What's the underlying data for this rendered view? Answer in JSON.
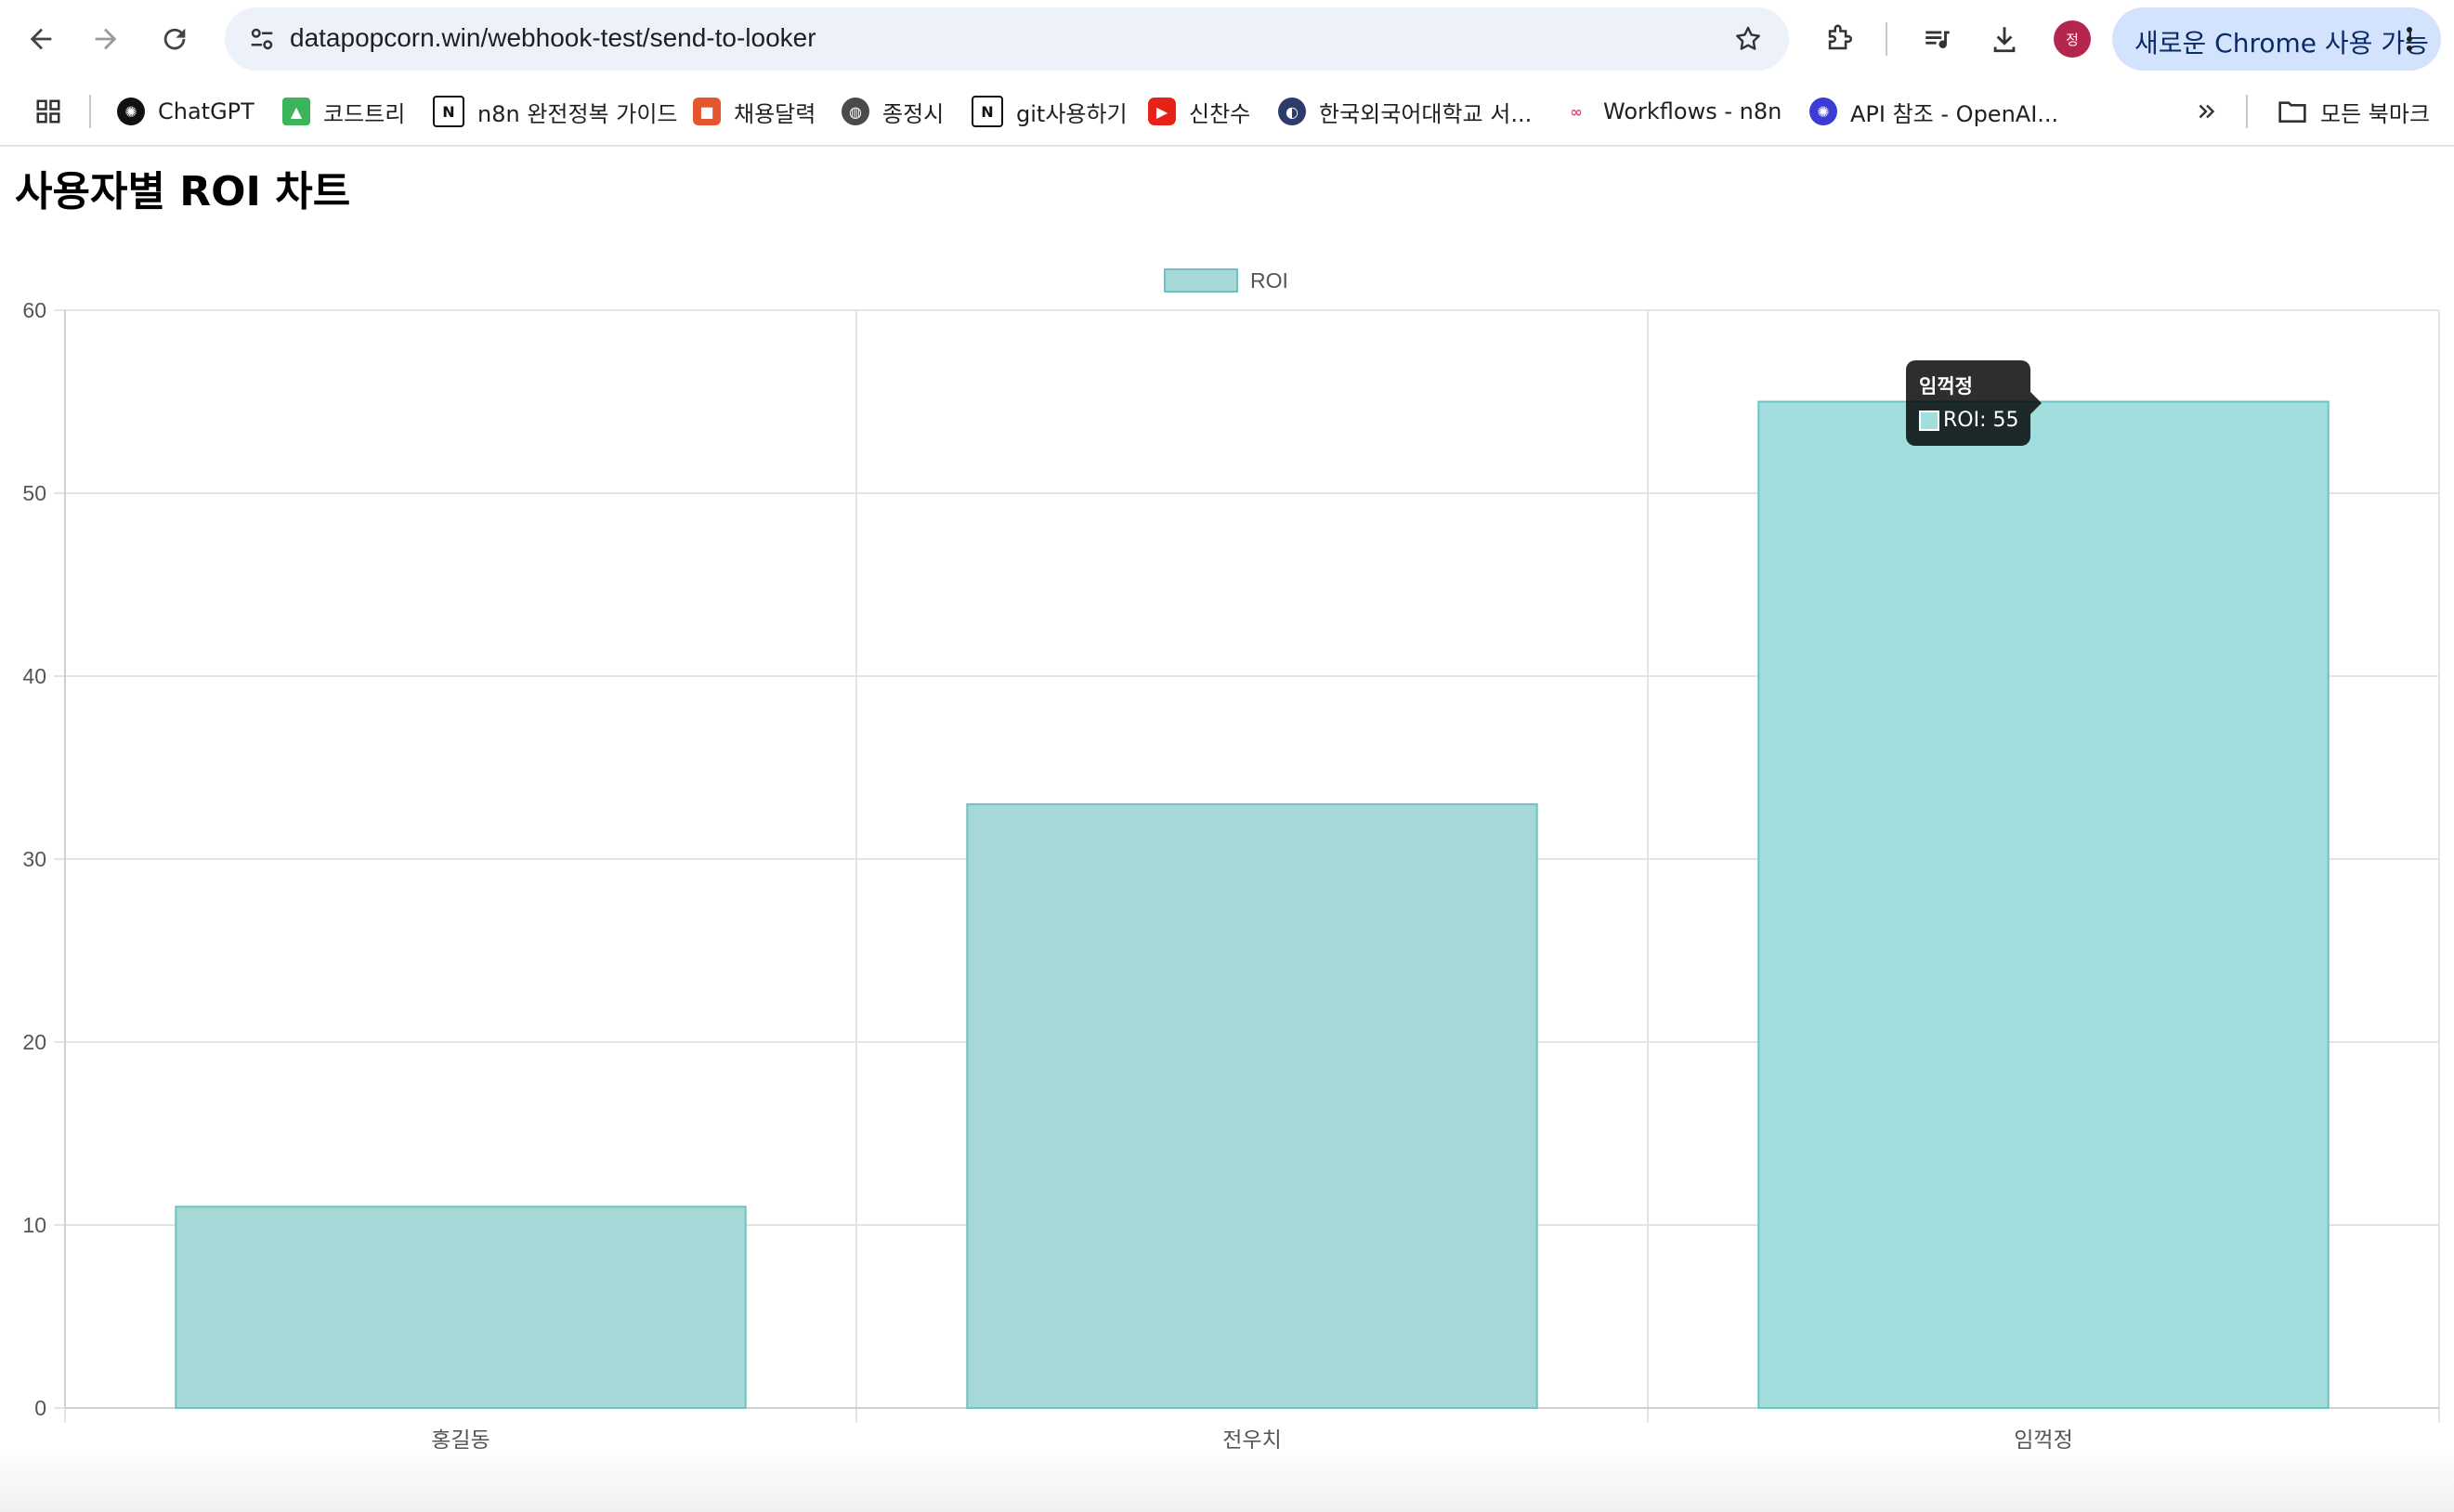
{
  "browser": {
    "url": "datapopcorn.win/webhook-test/send-to-looker",
    "avatar_initial": "정",
    "chrome_pill": "새로운 Chrome 사용 가능"
  },
  "bookmarks": [
    {
      "label": "ChatGPT",
      "icon": "chatgpt-icon"
    },
    {
      "label": "코드트리",
      "icon": "codetree-icon"
    },
    {
      "label": "n8n 완전정복 가이드",
      "icon": "notion-icon"
    },
    {
      "label": "채용달력",
      "icon": "calendar-icon"
    },
    {
      "label": "종정시",
      "icon": "globe-icon"
    },
    {
      "label": "git사용하기",
      "icon": "notion-icon"
    },
    {
      "label": "신찬수",
      "icon": "youtube-icon"
    },
    {
      "label": "한국외국어대학교 서...",
      "icon": "university-icon"
    },
    {
      "label": "Workflows - n8n",
      "icon": "n8n-icon"
    },
    {
      "label": "API 참조 - OpenAI...",
      "icon": "openai-icon"
    }
  ],
  "all_bookmarks_label": "모든 북마크",
  "page": {
    "title": "사용자별 ROI 차트"
  },
  "chart_data": {
    "type": "bar",
    "categories": [
      "홍길동",
      "전우치",
      "임꺽정"
    ],
    "series": [
      {
        "name": "ROI",
        "values": [
          11,
          33,
          55
        ]
      }
    ],
    "ylim": [
      0,
      60
    ],
    "yticks": [
      0,
      10,
      20,
      30,
      40,
      50,
      60
    ],
    "legend": "top-center",
    "grid": true,
    "colors": {
      "fill": "#a6d8d7",
      "stroke": "#6cc3c1",
      "hover_fill": "#a3dedf"
    }
  },
  "tooltip": {
    "title": "임꺽정",
    "text": "ROI: 55"
  }
}
